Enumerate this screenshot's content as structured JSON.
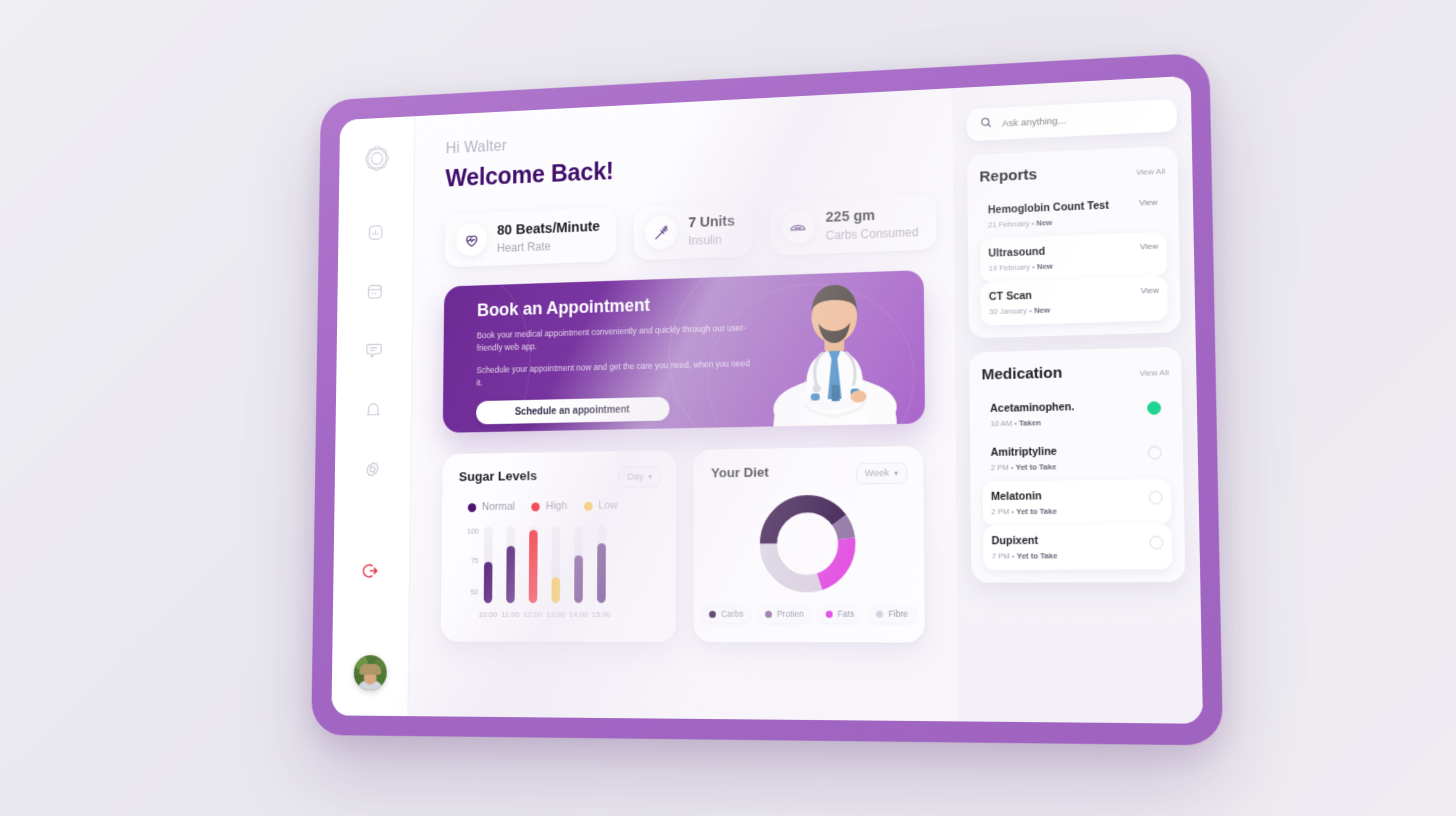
{
  "sidebar": {
    "items": [
      {
        "name": "logo-icon",
        "label": "Logo"
      },
      {
        "name": "analytics-icon",
        "label": "Analytics"
      },
      {
        "name": "calendar-icon",
        "label": "Calendar"
      },
      {
        "name": "chat-icon",
        "label": "Messages"
      },
      {
        "name": "bell-icon",
        "label": "Notifications"
      },
      {
        "name": "gear-icon",
        "label": "Settings"
      }
    ],
    "logout_label": "Log out",
    "avatar_label": "User avatar"
  },
  "header": {
    "greeting": "Hi Walter",
    "welcome": "Welcome Back!"
  },
  "stats": [
    {
      "icon": "heart-pulse-icon",
      "value": "80 Beats/Minute",
      "label": "Heart Rate"
    },
    {
      "icon": "syringe-icon",
      "value": "7 Units",
      "label": "Insulin"
    },
    {
      "icon": "bread-icon",
      "value": "225 gm",
      "label": "Carbs Consumed"
    }
  ],
  "banner": {
    "title": "Book an Appointment",
    "paragraph1": "Book your medical appointment conveniently and quickly through our user-friendly web app.",
    "paragraph2": "Schedule your appointment now and get the care you need, when you need it.",
    "button": "Schedule an appointment",
    "illustration": "doctor-illustration"
  },
  "sugar_card": {
    "title": "Sugar Levels",
    "range_label": "Day",
    "legend": [
      {
        "label": "Normal",
        "color": "#4b1570"
      },
      {
        "label": "High",
        "color": "#f5242d"
      },
      {
        "label": "Low",
        "color": "#f9c026"
      }
    ]
  },
  "diet_card": {
    "title": "Your Diet",
    "range_label": "Week"
  },
  "rail": {
    "search_placeholder": "Ask anything...",
    "reports": {
      "title": "Reports",
      "view_all": "View All",
      "view_label": "View",
      "items": [
        {
          "name": "Hemoglobin Count Test",
          "date": "21 February",
          "status": "New"
        },
        {
          "name": "Ultrasound",
          "date": "19 February",
          "status": "New"
        },
        {
          "name": "CT Scan",
          "date": "30 January",
          "status": "New"
        }
      ]
    },
    "medication": {
      "title": "Medication",
      "view_all": "View All",
      "items": [
        {
          "name": "Acetaminophen.",
          "time": "10 AM",
          "status": "Taken",
          "taken": true
        },
        {
          "name": "Amitriptyline",
          "time": "2 PM",
          "status": "Yet to Take",
          "taken": false
        },
        {
          "name": "Melatonin",
          "time": "2 PM",
          "status": "Yet to Take",
          "taken": false
        },
        {
          "name": "Dupixent",
          "time": "7 PM",
          "status": "Yet to Take",
          "taken": false
        }
      ]
    }
  },
  "chart_data": [
    {
      "type": "bar",
      "title": "Sugar Levels",
      "xlabel": "",
      "ylabel": "",
      "ylim": [
        40,
        105
      ],
      "yticks": [
        100,
        75,
        50
      ],
      "grid": false,
      "legend_position": "top",
      "categories": [
        "10:00",
        "11:00",
        "12:00",
        "13:00",
        "14:00",
        "15:00"
      ],
      "values": [
        75,
        88,
        102,
        62,
        80,
        90
      ],
      "point_status": [
        "Normal",
        "Normal",
        "High",
        "Low",
        "Normal",
        "Normal"
      ],
      "colors": [
        "#4b1570",
        "#4b1570",
        "#f5242d",
        "#f9c026",
        "#4b1570",
        "#4b1570"
      ],
      "track_color": "#eee9f2"
    },
    {
      "type": "pie",
      "title": "Your Diet",
      "subtitle": "Week",
      "legend_position": "bottom",
      "categories": [
        "Carbs",
        "Protien",
        "Fats",
        "Fibre"
      ],
      "values": [
        40,
        8,
        22,
        30
      ],
      "colors": [
        "#2d0b42",
        "#8a6a9e",
        "#e040e0",
        "#d8cfe0"
      ]
    }
  ],
  "theme": {
    "bezel": "#a368c4",
    "accent_purple": "#6d2a95",
    "welcome_purple": "#3f0d6b",
    "logout_red": "#e8354e",
    "taken_green": "#1fd48f"
  }
}
